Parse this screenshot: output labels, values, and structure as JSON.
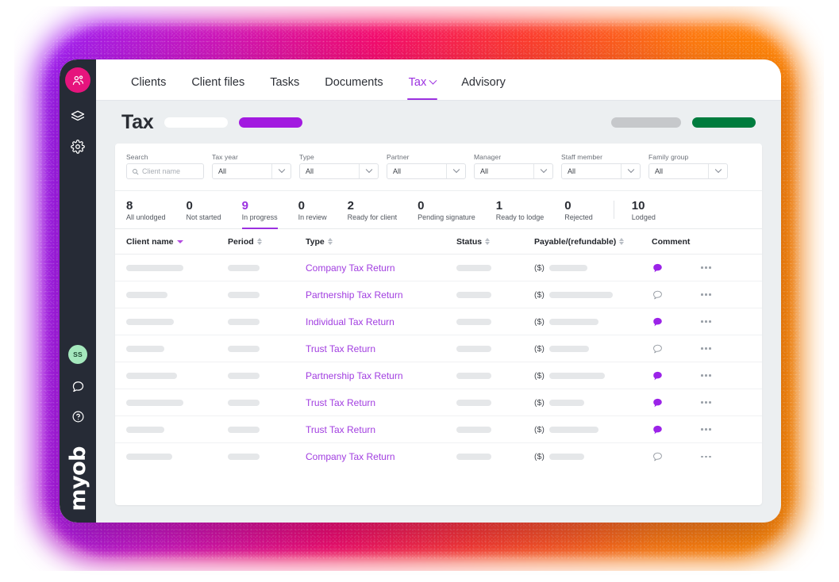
{
  "app": {
    "brand": "myob",
    "rail": {
      "clients_badge_icon": "people-icon",
      "layers_icon": "layers-icon",
      "settings_icon": "gear-icon",
      "avatar_initials": "SS",
      "chat_icon": "chat-bubble-icon",
      "help_icon": "question-circle-icon"
    }
  },
  "topnav": {
    "items": [
      {
        "label": "Clients",
        "active": false,
        "has_chevron": false
      },
      {
        "label": "Client files",
        "active": false,
        "has_chevron": false
      },
      {
        "label": "Tasks",
        "active": false,
        "has_chevron": false
      },
      {
        "label": "Documents",
        "active": false,
        "has_chevron": false
      },
      {
        "label": "Tax",
        "active": true,
        "has_chevron": true
      },
      {
        "label": "Advisory",
        "active": false,
        "has_chevron": false
      }
    ]
  },
  "page": {
    "title": "Tax",
    "accent_purple": "#a21ae0",
    "accent_green": "#007c3e"
  },
  "filters": [
    {
      "label": "Search",
      "type": "search",
      "placeholder": "Client name",
      "value": ""
    },
    {
      "label": "Tax year",
      "type": "select",
      "value": "All"
    },
    {
      "label": "Type",
      "type": "select",
      "value": "All"
    },
    {
      "label": "Partner",
      "type": "select",
      "value": "All"
    },
    {
      "label": "Manager",
      "type": "select",
      "value": "All"
    },
    {
      "label": "Staff member",
      "type": "select",
      "value": "All"
    },
    {
      "label": "Family group",
      "type": "select",
      "value": "All"
    }
  ],
  "status_tabs": [
    {
      "count": "8",
      "label": "All unlodged",
      "active": false,
      "divider_before": false
    },
    {
      "count": "0",
      "label": "Not started",
      "active": false,
      "divider_before": false
    },
    {
      "count": "9",
      "label": "In progress",
      "active": true,
      "divider_before": false
    },
    {
      "count": "0",
      "label": "In review",
      "active": false,
      "divider_before": false
    },
    {
      "count": "2",
      "label": "Ready for client",
      "active": false,
      "divider_before": false
    },
    {
      "count": "0",
      "label": "Pending signature",
      "active": false,
      "divider_before": false
    },
    {
      "count": "1",
      "label": "Ready to lodge",
      "active": false,
      "divider_before": false
    },
    {
      "count": "0",
      "label": "Rejected",
      "active": false,
      "divider_before": false
    },
    {
      "count": "10",
      "label": "Lodged",
      "active": false,
      "divider_before": true
    }
  ],
  "table": {
    "columns": [
      {
        "label": "Client name",
        "sort": "desc-active"
      },
      {
        "label": "Period",
        "sort": "both"
      },
      {
        "label": "Type",
        "sort": "both"
      },
      {
        "label": "Status",
        "sort": "both"
      },
      {
        "label": "Payable/(refundable)",
        "sort": "both"
      },
      {
        "label": "Comment",
        "sort": "none"
      },
      {
        "label": "",
        "sort": "none"
      }
    ],
    "currency_prefix": "($)",
    "rows": [
      {
        "client_w": 72,
        "period_w": 40,
        "type": "Company Tax Return",
        "status_w": 44,
        "pay_w": 48,
        "comment": "filled"
      },
      {
        "client_w": 52,
        "period_w": 40,
        "type": "Partnership Tax Return",
        "status_w": 44,
        "pay_w": 80,
        "comment": "outline"
      },
      {
        "client_w": 60,
        "period_w": 40,
        "type": "Individual Tax Return",
        "status_w": 44,
        "pay_w": 62,
        "comment": "filled"
      },
      {
        "client_w": 48,
        "period_w": 40,
        "type": "Trust Tax Return",
        "status_w": 44,
        "pay_w": 50,
        "comment": "outline"
      },
      {
        "client_w": 64,
        "period_w": 40,
        "type": "Partnership Tax Return",
        "status_w": 44,
        "pay_w": 70,
        "comment": "filled"
      },
      {
        "client_w": 72,
        "period_w": 40,
        "type": "Trust Tax Return",
        "status_w": 44,
        "pay_w": 44,
        "comment": "filled"
      },
      {
        "client_w": 48,
        "period_w": 40,
        "type": "Trust Tax Return",
        "status_w": 44,
        "pay_w": 62,
        "comment": "filled"
      },
      {
        "client_w": 58,
        "period_w": 40,
        "type": "Company Tax Return",
        "status_w": 44,
        "pay_w": 44,
        "comment": "outline"
      }
    ]
  }
}
